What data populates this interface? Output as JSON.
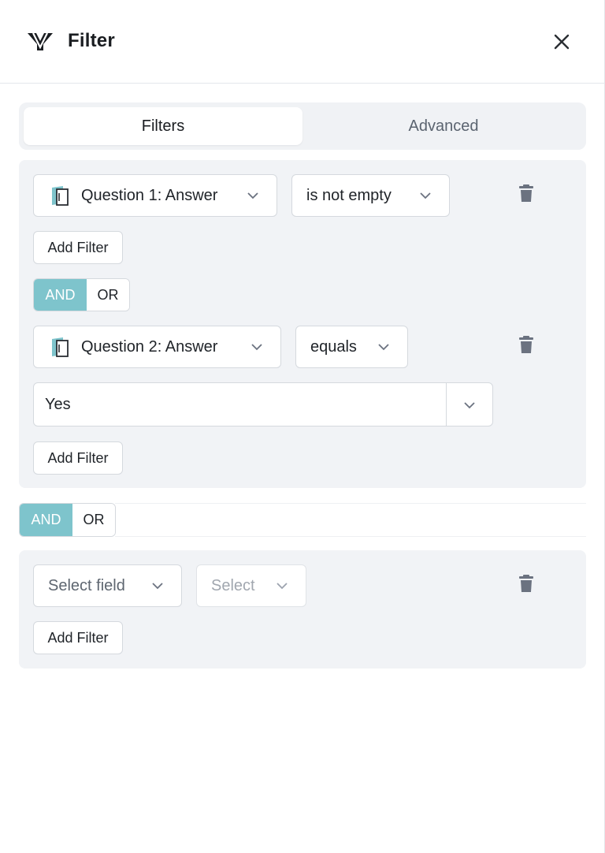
{
  "header": {
    "title": "Filter"
  },
  "tabs": [
    {
      "label": "Filters",
      "active": true
    },
    {
      "label": "Advanced",
      "active": false
    }
  ],
  "group1": {
    "filter1": {
      "field": "Question 1: Answer",
      "operator": "is not empty"
    },
    "add_filter_1": "Add Filter",
    "logic": {
      "and": "AND",
      "or": "OR",
      "selected": "AND"
    },
    "filter2": {
      "field": "Question 2: Answer",
      "operator": "equals",
      "value": "Yes"
    },
    "add_filter_2": "Add Filter"
  },
  "group_logic": {
    "and": "AND",
    "or": "OR",
    "selected": "AND"
  },
  "group2": {
    "filter1": {
      "field": "Select field",
      "operator": "Select"
    },
    "add_filter": "Add Filter"
  },
  "colors": {
    "accent": "#7ec4cc",
    "panel": "#f1f3f6",
    "border": "#d5d9de"
  }
}
